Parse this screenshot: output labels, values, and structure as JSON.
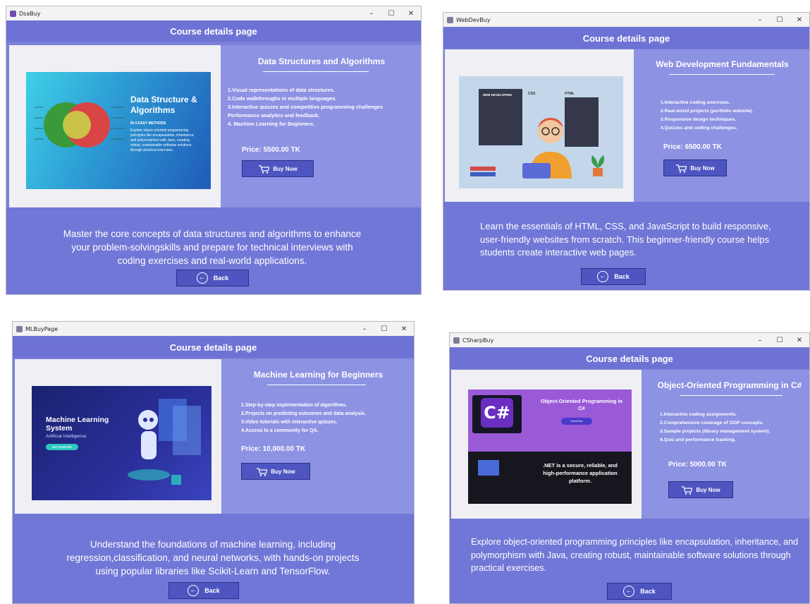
{
  "windows": [
    {
      "app_title": "DsaBuy",
      "header": "Course details page",
      "course_title": "Data Structures and Algorithms",
      "features": [
        "1.Visual representations of data structures.",
        "2.Code walkthroughs in multiple languages.",
        "3.Interactive quizzes and competitive programming challenges",
        "Performance analytics and feedback.",
        "4. Machine Learning for Beginners."
      ],
      "price": "Price: 5500.00 TK",
      "buy_label": "Buy Now",
      "description": "Master the core concepts of data structures and algorithms to enhance your problem-solvingskills and prepare for technical interviews with coding exercises and real-world applications.",
      "back_label": "Back",
      "image": {
        "title": "Data Structure & Algorithms",
        "subtitle": "IN 4 EASY METHODS",
        "body": "Explore object-oriented programming principles like encapsulation, inheritance, and polymorphism with Java, creating robust, maintainable software solutions through practical exercises."
      }
    },
    {
      "app_title": "WebDevBuy",
      "header": "Course details page",
      "course_title": "Web Development Fundamentals",
      "features": [
        "1.Interactive coding exercises.",
        "2.Real-world projects (portfolio website).",
        "3.Responsive design techniques.",
        "4.Quizzes and coding challenges."
      ],
      "price": "Price: 6500.00 TK",
      "buy_label": "Buy Now",
      "description": "Learn the essentials of HTML, CSS, and JavaScript to build responsive, user-friendly websites from scratch. This beginner-friendly course helps students create interactive web pages.",
      "back_label": "Back",
      "image": {
        "label_1": "WEB DEVELOPING",
        "label_2": "CSS",
        "label_3": "HTML"
      }
    },
    {
      "app_title": "MLBuyPage",
      "header": "Course details page",
      "course_title": "Machine Learning for Beginners",
      "features": [
        "1.Step-by-step implementation of algorithms.",
        "2.Projects on predicting outcomes and data analysis.",
        "3.Video tutorials with interactive quizzes.",
        "4.Access to a community for QA."
      ],
      "price": "Price: 10,000.00 TK",
      "buy_label": "Buy Now",
      "description": "Understand the foundations of machine learning, including regression,classification, and neural networks,  with hands-on projects using popular libraries like Scikit-Learn and TensorFlow.",
      "back_label": "Back",
      "image": {
        "title": "Machine Learning System",
        "subtitle": "Artificial Intelligence",
        "cta": "GET STARTED"
      }
    },
    {
      "app_title": "CSharpBuy",
      "header": "Course details page",
      "course_title": "Object-Oriented Programming in C#",
      "features": [
        "1.Interactive coding assignments.",
        "2.Comprehensive coverage of OOP concepts.",
        "3.Sample projects (library management system).",
        "4.Quiz and performance tracking."
      ],
      "price": "Price: 5000.00 TK",
      "buy_label": "Buy Now",
      "description": "Explore object-oriented programming principles like encapsulation, inheritance, and polymorphism with Java, creating robust, maintainable software solutions through practical exercises.",
      "back_label": "Back",
      "image": {
        "logo": "C#",
        "title": "Object-Oriented Programming in C#",
        "pill": "Enroll Now",
        "caption": ".NET is a secure, reliable, and high-performance application platform."
      }
    }
  ],
  "colors": {
    "window_bg": "#7b80d8",
    "header_bg": "#6d72d4",
    "info_bg": "#8d92e2",
    "bottom_bg": "#7177d6",
    "button_bg": "#4e55c0",
    "image_bg": "#f0f0f4"
  },
  "icons": {
    "buy": "cart-icon",
    "back": "back-arrow-icon",
    "minimize": "minimize-icon",
    "maximize": "maximize-icon",
    "close": "close-icon"
  }
}
